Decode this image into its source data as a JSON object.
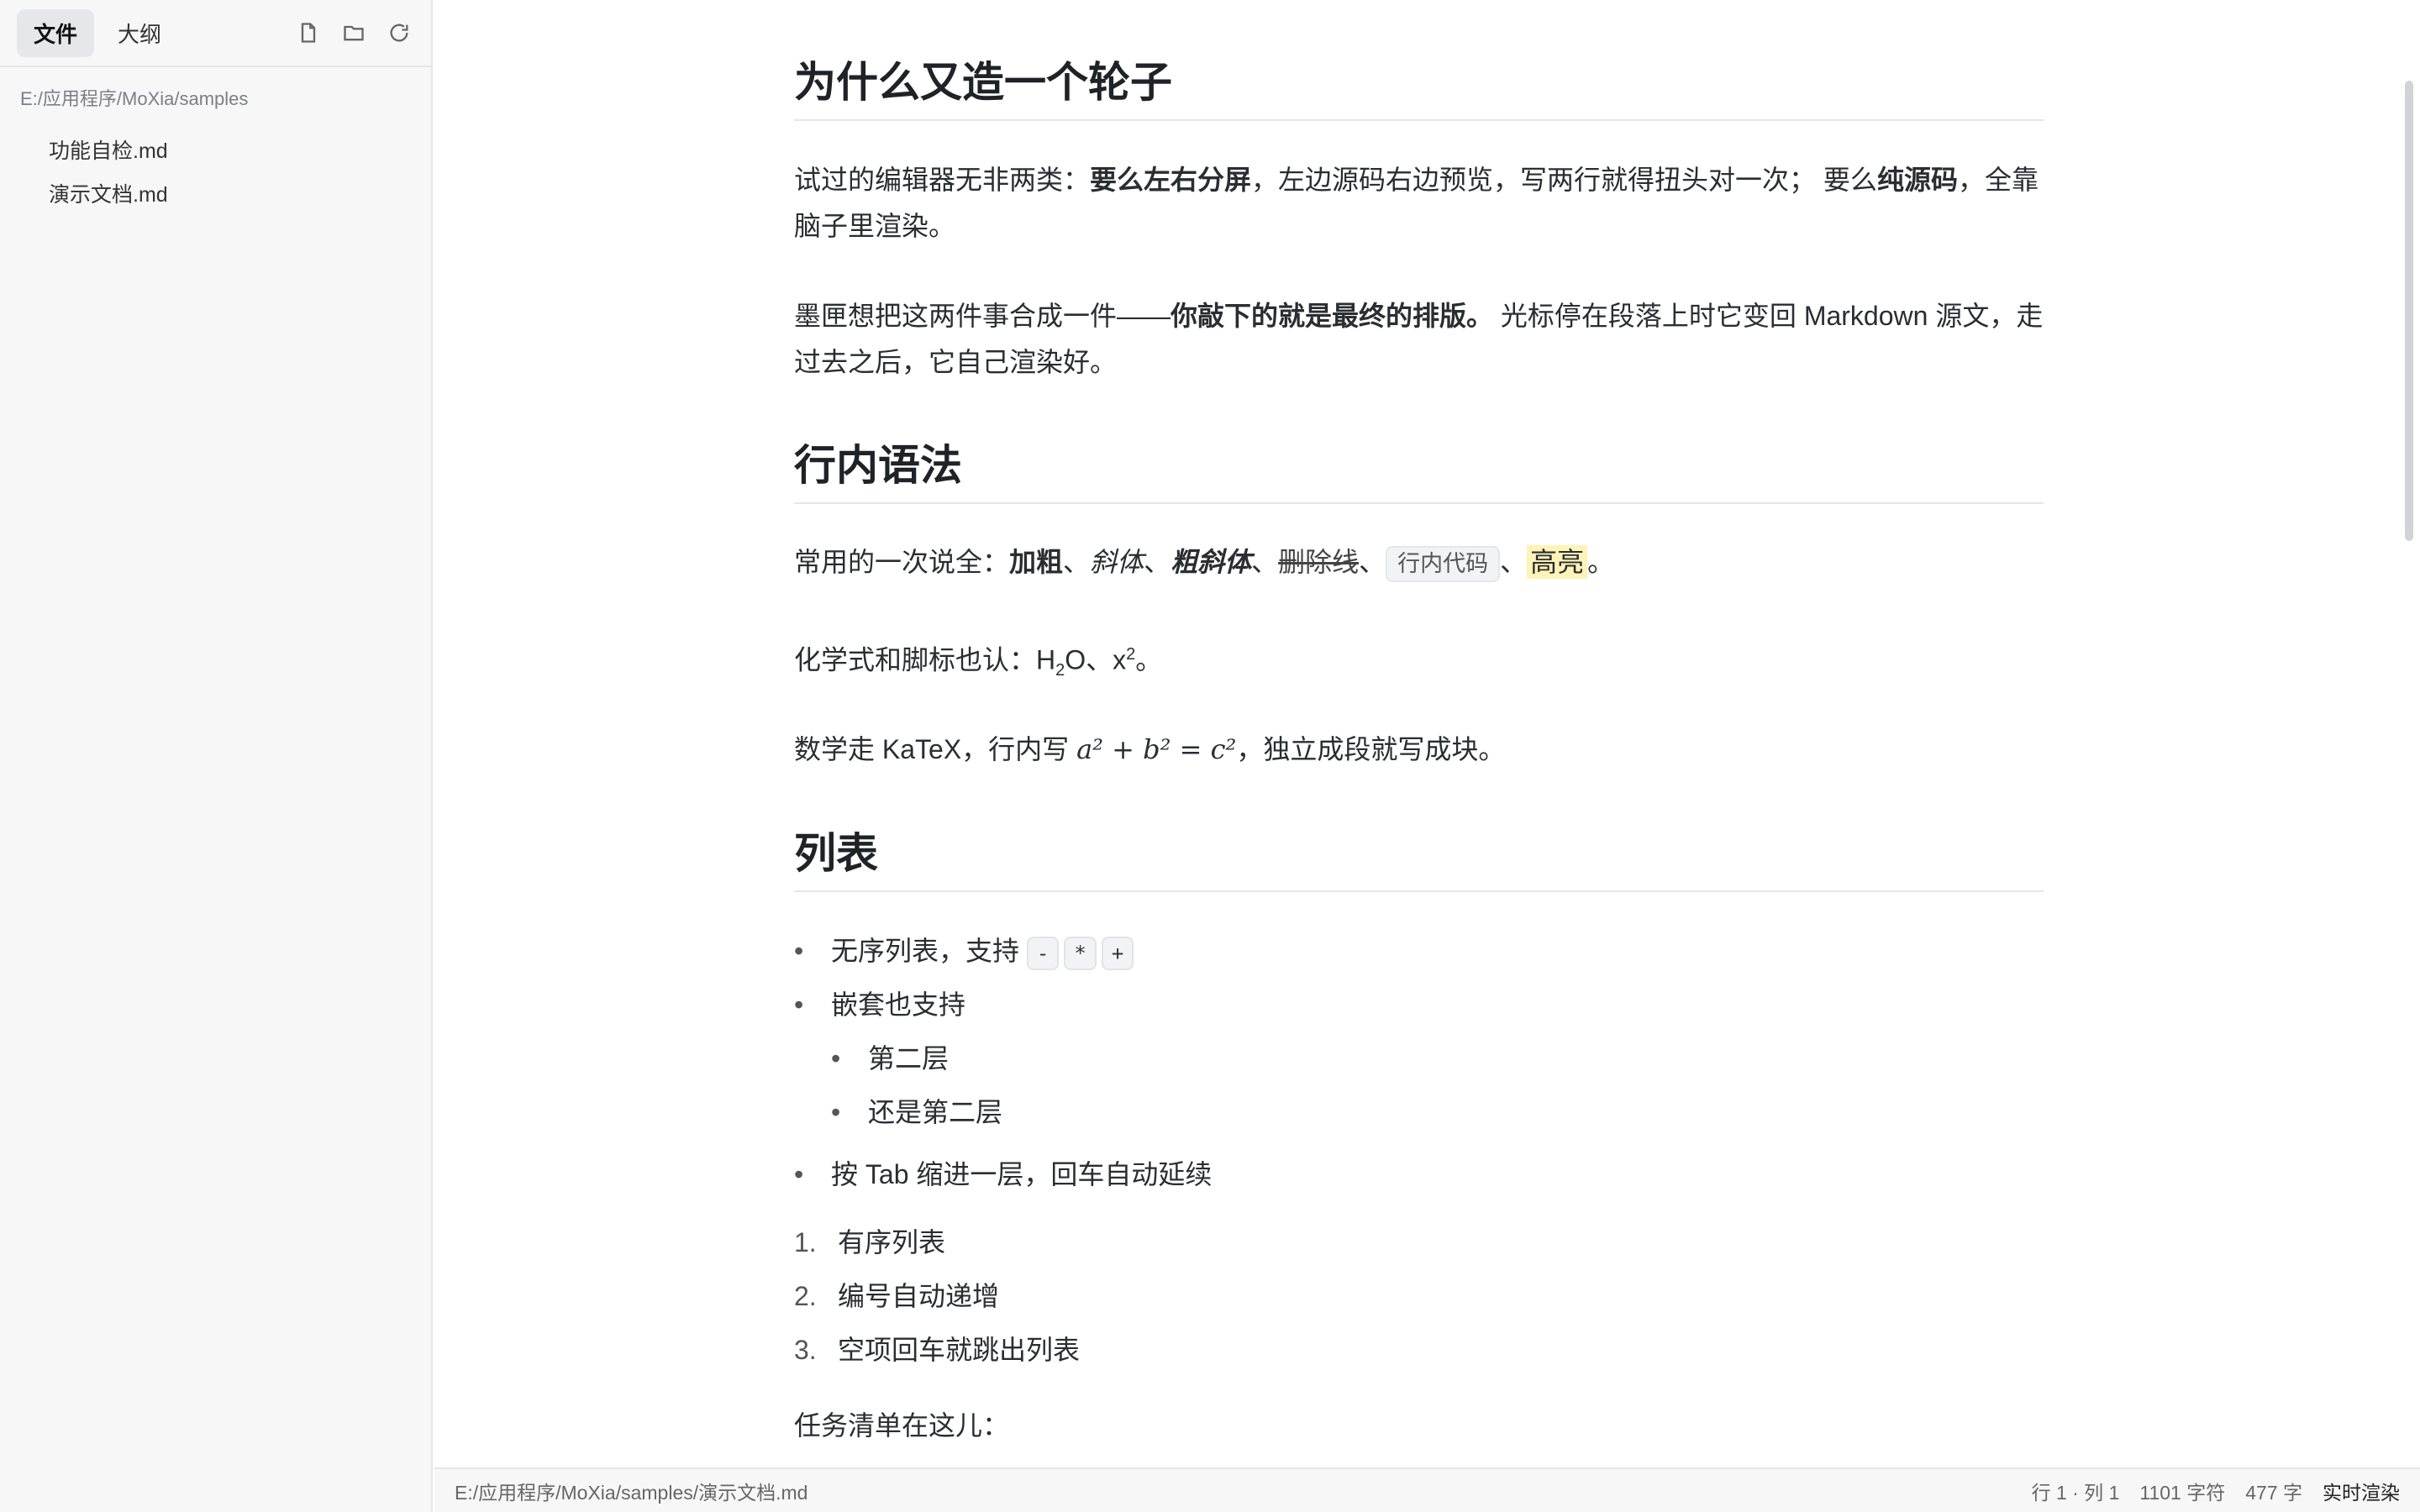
{
  "sidebar": {
    "tabs": [
      {
        "label": "文件",
        "active": true
      },
      {
        "label": "大纲",
        "active": false
      }
    ],
    "icons": [
      "new-file-icon",
      "open-folder-icon",
      "refresh-icon"
    ],
    "path": "E:/应用程序/MoXia/samples",
    "files": [
      "功能自检.md",
      "演示文档.md"
    ]
  },
  "doc": {
    "h1": "为什么又造一个轮子",
    "p1": {
      "a": "试过的编辑器无非两类：",
      "b1": "要么左右分屏",
      "c": "，左边源码右边预览，写两行就得扭头对一次； 要么",
      "b2": "纯源码",
      "d": "，全靠脑子里渲染。"
    },
    "p2": {
      "a": "墨匣想把这两件事合成一件——",
      "b": "你敲下的就是最终的排版。",
      "c": " 光标停在段落上时它变回 Markdown 源文，走过去之后，它自己渲染好。"
    },
    "h2": "行内语法",
    "p3": {
      "a": "常用的一次说全：",
      "bold": "加粗",
      "sep": "、",
      "italic": "斜体",
      "bolditalic": "粗斜体",
      "strike": "删除线",
      "code": "行内代码",
      "mark": "高亮",
      "end": "。"
    },
    "p4": {
      "a": "化学式和脚标也认：H",
      "sub": "2",
      "b": "O、x",
      "sup": "2",
      "c": "。"
    },
    "p5": {
      "a": "数学走 KaTeX，行内写 ",
      "math": "a² + b² = c²",
      "b": "，独立成段就写成块。"
    },
    "h3": "列表",
    "ul": {
      "item1": "无序列表，支持",
      "keys": [
        "-",
        "*",
        "+"
      ],
      "item2": "嵌套也支持",
      "nested": [
        "第二层",
        "还是第二层"
      ],
      "item3": "按 Tab 缩进一层，回车自动延续"
    },
    "ol": [
      {
        "num": "1.",
        "text": "有序列表"
      },
      {
        "num": "2.",
        "text": "编号自动递增"
      },
      {
        "num": "3.",
        "text": "空项回车就跳出列表"
      }
    ],
    "p6": "任务清单在这儿："
  },
  "status": {
    "path": "E:/应用程序/MoXia/samples/演示文档.md",
    "position": "行 1 · 列 1",
    "chars": "1101 字符",
    "words": "477 字",
    "mode": "实时渲染"
  }
}
